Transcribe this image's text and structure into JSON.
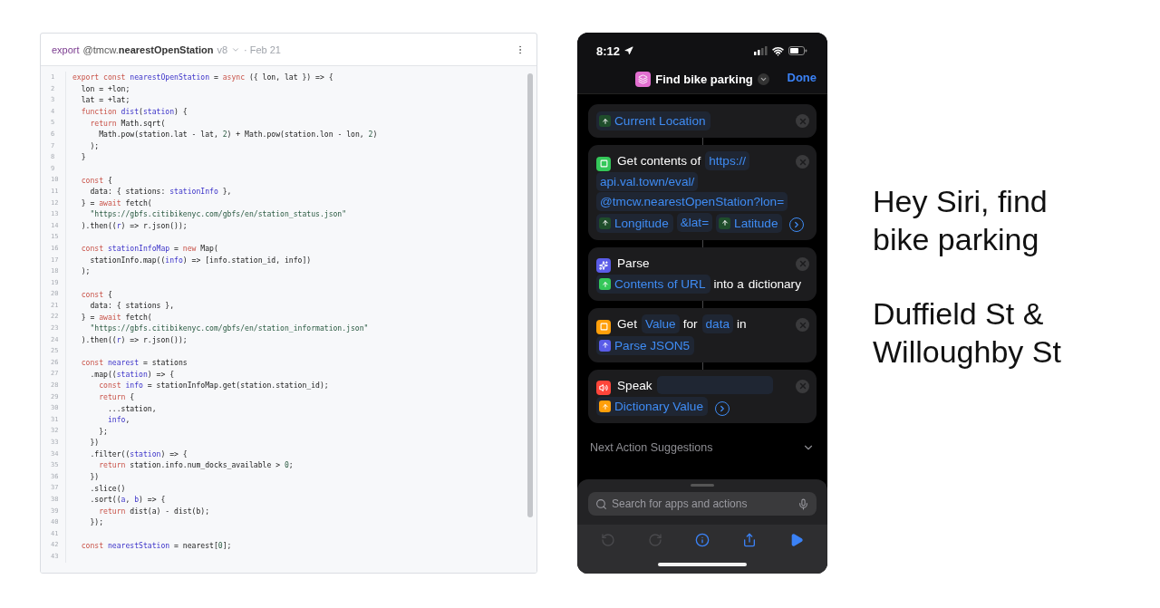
{
  "code_panel": {
    "header": {
      "keyword": "export",
      "handle": "@tmcw.",
      "name": "nearestOpenStation",
      "version": "v8",
      "date": "· Feb 21"
    },
    "lines": [
      {
        "number": "1",
        "tokens": [
          {
            "kind": "kw",
            "text": "export const "
          },
          {
            "kind": "name",
            "text": "nearestOpenStation"
          },
          {
            "kind": "plain",
            "text": " = "
          },
          {
            "kind": "kw",
            "text": "async"
          },
          {
            "kind": "plain",
            "text": " ({ lon, lat }) => {"
          }
        ]
      },
      {
        "number": "2",
        "tokens": [
          {
            "kind": "plain",
            "text": "  lon = +lon;"
          }
        ]
      },
      {
        "number": "3",
        "tokens": [
          {
            "kind": "plain",
            "text": "  lat = +lat;"
          }
        ]
      },
      {
        "number": "4",
        "tokens": [
          {
            "kind": "kw",
            "text": "  function "
          },
          {
            "kind": "name",
            "text": "dist"
          },
          {
            "kind": "plain",
            "text": "("
          },
          {
            "kind": "name",
            "text": "station"
          },
          {
            "kind": "plain",
            "text": ") {"
          }
        ]
      },
      {
        "number": "5",
        "tokens": [
          {
            "kind": "kw",
            "text": "    return "
          },
          {
            "kind": "plain",
            "text": "Math.sqrt("
          }
        ]
      },
      {
        "number": "6",
        "tokens": [
          {
            "kind": "plain",
            "text": "      Math.pow(station.lat - lat, "
          },
          {
            "kind": "num",
            "text": "2"
          },
          {
            "kind": "plain",
            "text": ") + Math.pow(station.lon - lon, "
          },
          {
            "kind": "num",
            "text": "2"
          },
          {
            "kind": "plain",
            "text": ")"
          }
        ]
      },
      {
        "number": "7",
        "tokens": [
          {
            "kind": "plain",
            "text": "    );"
          }
        ]
      },
      {
        "number": "8",
        "tokens": [
          {
            "kind": "plain",
            "text": "  }"
          }
        ]
      },
      {
        "number": "9"
      },
      {
        "number": "10",
        "tokens": [
          {
            "kind": "kw",
            "text": "  const "
          },
          {
            "kind": "plain",
            "text": "{"
          }
        ]
      },
      {
        "number": "11",
        "tokens": [
          {
            "kind": "plain",
            "text": "    data: { stations: "
          },
          {
            "kind": "name",
            "text": "stationInfo"
          },
          {
            "kind": "plain",
            "text": " },"
          }
        ]
      },
      {
        "number": "12",
        "tokens": [
          {
            "kind": "plain",
            "text": "  } = "
          },
          {
            "kind": "kw",
            "text": "await"
          },
          {
            "kind": "plain",
            "text": " fetch("
          }
        ]
      },
      {
        "number": "13",
        "tokens": [
          {
            "kind": "str",
            "text": "    \"https://gbfs.citibikenyc.com/gbfs/en/station_status.json\""
          }
        ]
      },
      {
        "number": "14",
        "tokens": [
          {
            "kind": "plain",
            "text": "  ).then(("
          },
          {
            "kind": "name",
            "text": "r"
          },
          {
            "kind": "plain",
            "text": ") => r.json());"
          }
        ]
      },
      {
        "number": "15"
      },
      {
        "number": "16",
        "tokens": [
          {
            "kind": "kw",
            "text": "  const "
          },
          {
            "kind": "name",
            "text": "stationInfoMap"
          },
          {
            "kind": "plain",
            "text": " = "
          },
          {
            "kind": "kw",
            "text": "new"
          },
          {
            "kind": "plain",
            "text": " Map("
          }
        ]
      },
      {
        "number": "17",
        "tokens": [
          {
            "kind": "plain",
            "text": "    stationInfo.map(("
          },
          {
            "kind": "name",
            "text": "info"
          },
          {
            "kind": "plain",
            "text": ") => [info.station_id, info])"
          }
        ]
      },
      {
        "number": "18",
        "tokens": [
          {
            "kind": "plain",
            "text": "  );"
          }
        ]
      },
      {
        "number": "19"
      },
      {
        "number": "20",
        "tokens": [
          {
            "kind": "kw",
            "text": "  const "
          },
          {
            "kind": "plain",
            "text": "{"
          }
        ]
      },
      {
        "number": "21",
        "tokens": [
          {
            "kind": "plain",
            "text": "    data: { stations },"
          }
        ]
      },
      {
        "number": "22",
        "tokens": [
          {
            "kind": "plain",
            "text": "  } = "
          },
          {
            "kind": "kw",
            "text": "await"
          },
          {
            "kind": "plain",
            "text": " fetch("
          }
        ]
      },
      {
        "number": "23",
        "tokens": [
          {
            "kind": "str",
            "text": "    \"https://gbfs.citibikenyc.com/gbfs/en/station_information.json\""
          }
        ]
      },
      {
        "number": "24",
        "tokens": [
          {
            "kind": "plain",
            "text": "  ).then(("
          },
          {
            "kind": "name",
            "text": "r"
          },
          {
            "kind": "plain",
            "text": ") => r.json());"
          }
        ]
      },
      {
        "number": "25"
      },
      {
        "number": "26",
        "tokens": [
          {
            "kind": "kw",
            "text": "  const "
          },
          {
            "kind": "name",
            "text": "nearest"
          },
          {
            "kind": "plain",
            "text": " = stations"
          }
        ]
      },
      {
        "number": "27",
        "tokens": [
          {
            "kind": "plain",
            "text": "    .map(("
          },
          {
            "kind": "name",
            "text": "station"
          },
          {
            "kind": "plain",
            "text": ") => {"
          }
        ]
      },
      {
        "number": "28",
        "tokens": [
          {
            "kind": "kw",
            "text": "      const "
          },
          {
            "kind": "name",
            "text": "info"
          },
          {
            "kind": "plain",
            "text": " = stationInfoMap.get(station.station_id);"
          }
        ]
      },
      {
        "number": "29",
        "tokens": [
          {
            "kind": "kw",
            "text": "      return "
          },
          {
            "kind": "plain",
            "text": "{"
          }
        ]
      },
      {
        "number": "30",
        "tokens": [
          {
            "kind": "plain",
            "text": "        ...station,"
          }
        ]
      },
      {
        "number": "31",
        "tokens": [
          {
            "kind": "name",
            "text": "        info"
          },
          {
            "kind": "plain",
            "text": ","
          }
        ]
      },
      {
        "number": "32",
        "tokens": [
          {
            "kind": "plain",
            "text": "      };"
          }
        ]
      },
      {
        "number": "33",
        "tokens": [
          {
            "kind": "plain",
            "text": "    })"
          }
        ]
      },
      {
        "number": "34",
        "tokens": [
          {
            "kind": "plain",
            "text": "    .filter(("
          },
          {
            "kind": "name",
            "text": "station"
          },
          {
            "kind": "plain",
            "text": ") => {"
          }
        ]
      },
      {
        "number": "35",
        "tokens": [
          {
            "kind": "kw",
            "text": "      return "
          },
          {
            "kind": "plain",
            "text": "station.info.num_docks_available > "
          },
          {
            "kind": "num",
            "text": "0"
          },
          {
            "kind": "plain",
            "text": ";"
          }
        ]
      },
      {
        "number": "36",
        "tokens": [
          {
            "kind": "plain",
            "text": "    })"
          }
        ]
      },
      {
        "number": "37",
        "tokens": [
          {
            "kind": "plain",
            "text": "    .slice()"
          }
        ]
      },
      {
        "number": "38",
        "tokens": [
          {
            "kind": "plain",
            "text": "    .sort(("
          },
          {
            "kind": "name",
            "text": "a"
          },
          {
            "kind": "plain",
            "text": ", "
          },
          {
            "kind": "name",
            "text": "b"
          },
          {
            "kind": "plain",
            "text": ") => {"
          }
        ]
      },
      {
        "number": "39",
        "tokens": [
          {
            "kind": "kw",
            "text": "      return "
          },
          {
            "kind": "plain",
            "text": "dist(a) - dist(b);"
          }
        ]
      },
      {
        "number": "40",
        "tokens": [
          {
            "kind": "plain",
            "text": "    });"
          }
        ]
      },
      {
        "number": "41"
      },
      {
        "number": "42",
        "tokens": [
          {
            "kind": "kw",
            "text": "  const "
          },
          {
            "kind": "name",
            "text": "nearestStation"
          },
          {
            "kind": "plain",
            "text": " = nearest["
          },
          {
            "kind": "num",
            "text": "0"
          },
          {
            "kind": "plain",
            "text": "];"
          }
        ]
      },
      {
        "number": "43"
      }
    ]
  },
  "phone": {
    "status_bar": {
      "time": "8:12"
    },
    "nav": {
      "title": "Find bike parking",
      "done": "Done"
    },
    "actions": [
      {
        "kind": "variable_only",
        "expandable": false,
        "parts": [
          {
            "kind": "variable",
            "text": "Current Location",
            "color": "#1f4d2b"
          }
        ]
      },
      {
        "kind": "web",
        "color": "#34c759",
        "expandable": true,
        "parts": [
          {
            "kind": "text",
            "text": "Get contents of"
          },
          {
            "kind": "field",
            "text": "https://"
          },
          {
            "kind": "field",
            "text": "api.val.town/eval/"
          },
          {
            "kind": "field",
            "text": "@tmcw.nearestOpenStation?lon="
          },
          {
            "kind": "variable",
            "text": "Longitude",
            "color": "#1f4d2b"
          },
          {
            "kind": "field",
            "text": "&lat="
          },
          {
            "kind": "variable",
            "text": "Latitude",
            "color": "#1f4d2b"
          }
        ]
      },
      {
        "kind": "parse",
        "color": "#5a5ce8",
        "expandable": false,
        "parts": [
          {
            "kind": "text",
            "text": "Parse"
          },
          {
            "kind": "break"
          },
          {
            "kind": "variable",
            "text": "Contents of URL",
            "color": "#34c759"
          },
          {
            "kind": "text",
            "text": "into a"
          },
          {
            "kind": "text",
            "text": "dictionary"
          }
        ]
      },
      {
        "kind": "dictionary",
        "color": "#ff9f0a",
        "expandable": false,
        "parts": [
          {
            "kind": "text",
            "text": "Get"
          },
          {
            "kind": "field",
            "text": "Value"
          },
          {
            "kind": "text",
            "text": "for"
          },
          {
            "kind": "field",
            "text": "data"
          },
          {
            "kind": "text",
            "text": "in"
          },
          {
            "kind": "variable",
            "text": "Parse JSON5",
            "color": "#5a5ce8"
          }
        ]
      },
      {
        "kind": "speak",
        "color": "#ff453a",
        "expandable": true,
        "parts": [
          {
            "kind": "text",
            "text": "Speak"
          },
          {
            "kind": "blank"
          },
          {
            "kind": "variable",
            "text": "Dictionary Value",
            "color": "#ff9f0a"
          }
        ]
      }
    ],
    "suggestions": {
      "label": "Next Action Suggestions",
      "expanded": false
    },
    "search": {
      "placeholder": "Search for apps and actions"
    },
    "toolbar": [
      {
        "kind": "undo",
        "disabled": true
      },
      {
        "kind": "redo",
        "disabled": true
      },
      {
        "kind": "info",
        "disabled": false
      },
      {
        "kind": "share",
        "disabled": false
      },
      {
        "kind": "play",
        "disabled": false
      }
    ]
  },
  "caption": {
    "paragraphs": [
      "Hey Siri, find bike parking",
      "Duffield St & Willoughby St"
    ]
  }
}
